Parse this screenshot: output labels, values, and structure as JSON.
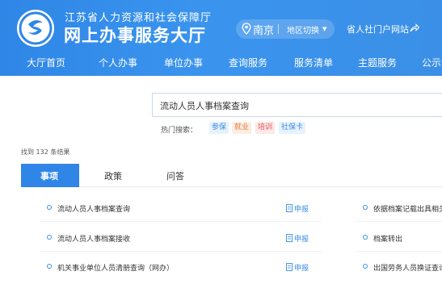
{
  "header": {
    "subtitle": "江苏省人力资源和社会保障厅",
    "title": "网上办事服务大厅",
    "city": "南京",
    "region_switch": "地区切换",
    "portal_link": "省人社门户网站",
    "brand_color": "#2f86e6"
  },
  "nav": {
    "items": [
      "大厅首页",
      "个人办事",
      "单位办事",
      "查询服务",
      "服务清单",
      "主题服务",
      "公示"
    ]
  },
  "search": {
    "value": "流动人员人事档案查询",
    "hot_label": "热门搜索：",
    "hot_tags": [
      {
        "label": "参保",
        "color": "#3a8ee6",
        "bg": "#e8f2fd"
      },
      {
        "label": "就业",
        "color": "#e07a3a",
        "bg": "#fdeee3"
      },
      {
        "label": "培训",
        "color": "#e05a5a",
        "bg": "#fde8e8"
      },
      {
        "label": "社保卡",
        "color": "#3a8ee6",
        "bg": "#e8f2fd"
      }
    ]
  },
  "results": {
    "count_text": "找到 132 条结果",
    "tabs": [
      "事项",
      "政策",
      "问答"
    ],
    "active_tab": 0,
    "left_items": [
      {
        "title": "流动人员人事档案查询",
        "action": "申报"
      },
      {
        "title": "流动人员人事档案接收",
        "action": "申报"
      },
      {
        "title": "机关事业单位人员清册查询（网办）",
        "action": "申报"
      }
    ],
    "right_items": [
      {
        "title": "依据档案记载出具相关"
      },
      {
        "title": "档案转出"
      },
      {
        "title": "出国劳务人员换证查询"
      }
    ]
  }
}
